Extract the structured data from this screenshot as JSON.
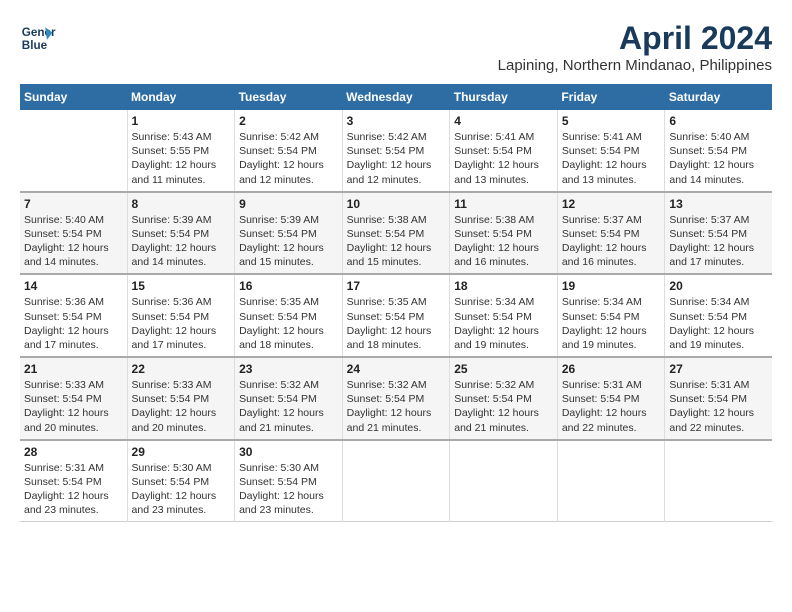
{
  "header": {
    "logo_line1": "General",
    "logo_line2": "Blue",
    "title": "April 2024",
    "subtitle": "Lapining, Northern Mindanao, Philippines"
  },
  "days_of_week": [
    "Sunday",
    "Monday",
    "Tuesday",
    "Wednesday",
    "Thursday",
    "Friday",
    "Saturday"
  ],
  "weeks": [
    [
      {
        "num": "",
        "info": ""
      },
      {
        "num": "1",
        "info": "Sunrise: 5:43 AM\nSunset: 5:55 PM\nDaylight: 12 hours\nand 11 minutes."
      },
      {
        "num": "2",
        "info": "Sunrise: 5:42 AM\nSunset: 5:54 PM\nDaylight: 12 hours\nand 12 minutes."
      },
      {
        "num": "3",
        "info": "Sunrise: 5:42 AM\nSunset: 5:54 PM\nDaylight: 12 hours\nand 12 minutes."
      },
      {
        "num": "4",
        "info": "Sunrise: 5:41 AM\nSunset: 5:54 PM\nDaylight: 12 hours\nand 13 minutes."
      },
      {
        "num": "5",
        "info": "Sunrise: 5:41 AM\nSunset: 5:54 PM\nDaylight: 12 hours\nand 13 minutes."
      },
      {
        "num": "6",
        "info": "Sunrise: 5:40 AM\nSunset: 5:54 PM\nDaylight: 12 hours\nand 14 minutes."
      }
    ],
    [
      {
        "num": "7",
        "info": "Sunrise: 5:40 AM\nSunset: 5:54 PM\nDaylight: 12 hours\nand 14 minutes."
      },
      {
        "num": "8",
        "info": "Sunrise: 5:39 AM\nSunset: 5:54 PM\nDaylight: 12 hours\nand 14 minutes."
      },
      {
        "num": "9",
        "info": "Sunrise: 5:39 AM\nSunset: 5:54 PM\nDaylight: 12 hours\nand 15 minutes."
      },
      {
        "num": "10",
        "info": "Sunrise: 5:38 AM\nSunset: 5:54 PM\nDaylight: 12 hours\nand 15 minutes."
      },
      {
        "num": "11",
        "info": "Sunrise: 5:38 AM\nSunset: 5:54 PM\nDaylight: 12 hours\nand 16 minutes."
      },
      {
        "num": "12",
        "info": "Sunrise: 5:37 AM\nSunset: 5:54 PM\nDaylight: 12 hours\nand 16 minutes."
      },
      {
        "num": "13",
        "info": "Sunrise: 5:37 AM\nSunset: 5:54 PM\nDaylight: 12 hours\nand 17 minutes."
      }
    ],
    [
      {
        "num": "14",
        "info": "Sunrise: 5:36 AM\nSunset: 5:54 PM\nDaylight: 12 hours\nand 17 minutes."
      },
      {
        "num": "15",
        "info": "Sunrise: 5:36 AM\nSunset: 5:54 PM\nDaylight: 12 hours\nand 17 minutes."
      },
      {
        "num": "16",
        "info": "Sunrise: 5:35 AM\nSunset: 5:54 PM\nDaylight: 12 hours\nand 18 minutes."
      },
      {
        "num": "17",
        "info": "Sunrise: 5:35 AM\nSunset: 5:54 PM\nDaylight: 12 hours\nand 18 minutes."
      },
      {
        "num": "18",
        "info": "Sunrise: 5:34 AM\nSunset: 5:54 PM\nDaylight: 12 hours\nand 19 minutes."
      },
      {
        "num": "19",
        "info": "Sunrise: 5:34 AM\nSunset: 5:54 PM\nDaylight: 12 hours\nand 19 minutes."
      },
      {
        "num": "20",
        "info": "Sunrise: 5:34 AM\nSunset: 5:54 PM\nDaylight: 12 hours\nand 19 minutes."
      }
    ],
    [
      {
        "num": "21",
        "info": "Sunrise: 5:33 AM\nSunset: 5:54 PM\nDaylight: 12 hours\nand 20 minutes."
      },
      {
        "num": "22",
        "info": "Sunrise: 5:33 AM\nSunset: 5:54 PM\nDaylight: 12 hours\nand 20 minutes."
      },
      {
        "num": "23",
        "info": "Sunrise: 5:32 AM\nSunset: 5:54 PM\nDaylight: 12 hours\nand 21 minutes."
      },
      {
        "num": "24",
        "info": "Sunrise: 5:32 AM\nSunset: 5:54 PM\nDaylight: 12 hours\nand 21 minutes."
      },
      {
        "num": "25",
        "info": "Sunrise: 5:32 AM\nSunset: 5:54 PM\nDaylight: 12 hours\nand 21 minutes."
      },
      {
        "num": "26",
        "info": "Sunrise: 5:31 AM\nSunset: 5:54 PM\nDaylight: 12 hours\nand 22 minutes."
      },
      {
        "num": "27",
        "info": "Sunrise: 5:31 AM\nSunset: 5:54 PM\nDaylight: 12 hours\nand 22 minutes."
      }
    ],
    [
      {
        "num": "28",
        "info": "Sunrise: 5:31 AM\nSunset: 5:54 PM\nDaylight: 12 hours\nand 23 minutes."
      },
      {
        "num": "29",
        "info": "Sunrise: 5:30 AM\nSunset: 5:54 PM\nDaylight: 12 hours\nand 23 minutes."
      },
      {
        "num": "30",
        "info": "Sunrise: 5:30 AM\nSunset: 5:54 PM\nDaylight: 12 hours\nand 23 minutes."
      },
      {
        "num": "",
        "info": ""
      },
      {
        "num": "",
        "info": ""
      },
      {
        "num": "",
        "info": ""
      },
      {
        "num": "",
        "info": ""
      }
    ]
  ]
}
